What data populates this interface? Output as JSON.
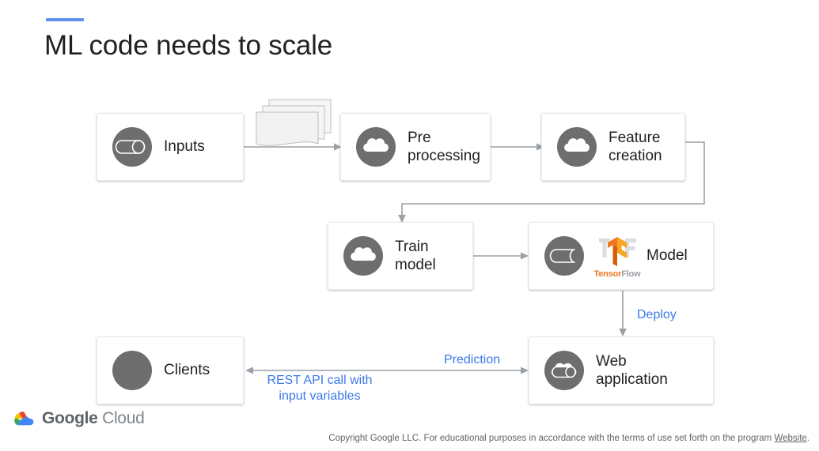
{
  "slide": {
    "title": "ML code needs to scale",
    "accent_color": "#5e8eec"
  },
  "diagram": {
    "nodes": [
      {
        "id": "inputs",
        "label": "Inputs",
        "icon": "database-cylinder-icon"
      },
      {
        "id": "pre",
        "label": "Pre\nprocessing",
        "icon": "cloud-icon"
      },
      {
        "id": "feature",
        "label": "Feature\ncreation",
        "icon": "cloud-icon"
      },
      {
        "id": "train",
        "label": "Train\nmodel",
        "icon": "cloud-icon"
      },
      {
        "id": "model",
        "label": "Model",
        "icon": "model-cylinder-icon",
        "logo": "tensorflow-logo"
      },
      {
        "id": "clients",
        "label": "Clients",
        "icon": "solid-circle-icon"
      },
      {
        "id": "webapp",
        "label": "Web\napplication",
        "icon": "cloud-cylinder-icon"
      }
    ],
    "edge_labels": {
      "deploy": "Deploy",
      "prediction": "Prediction",
      "rest_api": "REST API call with\ninput variables"
    },
    "edge_label_color": "#3c78e8",
    "connector_color": "#9aa0a6",
    "icon_color": "#6e6e6e"
  },
  "tensorflow": {
    "word_1": "Tensor",
    "word_2": "Flow",
    "color_1": "#ef7622",
    "color_2": "#9aa0a6"
  },
  "footer": {
    "brand_1": "Google",
    "brand_2": "Cloud",
    "copyright_before": "Copyright Google LLC. For educational purposes in accordance with the terms of use set forth on the program ",
    "copyright_link": "Website",
    "copyright_after": "."
  }
}
